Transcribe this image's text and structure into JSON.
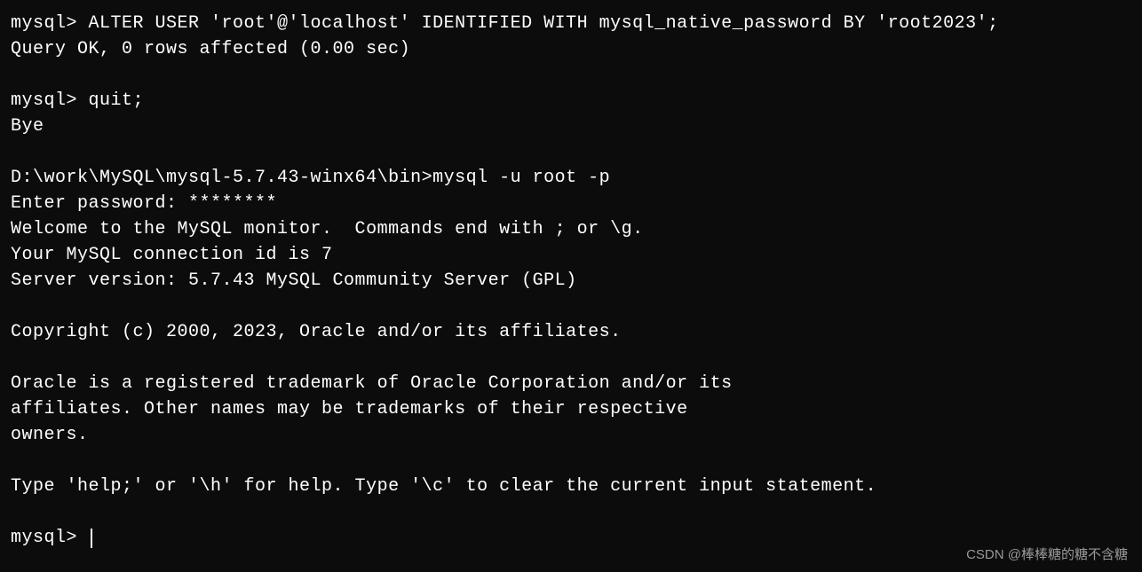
{
  "terminal": {
    "lines": [
      {
        "type": "prompt-cmd",
        "prompt": "mysql>",
        "command": " ALTER USER 'root'@'localhost' IDENTIFIED WITH mysql_native_password BY 'root2023';"
      },
      {
        "type": "output",
        "text": "Query OK, 0 rows affected (0.00 sec)"
      },
      {
        "type": "blank",
        "text": ""
      },
      {
        "type": "prompt-cmd",
        "prompt": "mysql>",
        "command": " quit;"
      },
      {
        "type": "output",
        "text": "Bye"
      },
      {
        "type": "blank",
        "text": ""
      },
      {
        "type": "shell-cmd",
        "prompt": "D:\\work\\MySQL\\mysql-5.7.43-winx64\\bin>",
        "command": "mysql -u root -p"
      },
      {
        "type": "output",
        "text": "Enter password: ********"
      },
      {
        "type": "output",
        "text": "Welcome to the MySQL monitor.  Commands end with ; or \\g."
      },
      {
        "type": "output",
        "text": "Your MySQL connection id is 7"
      },
      {
        "type": "output",
        "text": "Server version: 5.7.43 MySQL Community Server (GPL)"
      },
      {
        "type": "blank",
        "text": ""
      },
      {
        "type": "output",
        "text": "Copyright (c) 2000, 2023, Oracle and/or its affiliates."
      },
      {
        "type": "blank",
        "text": ""
      },
      {
        "type": "output",
        "text": "Oracle is a registered trademark of Oracle Corporation and/or its"
      },
      {
        "type": "output",
        "text": "affiliates. Other names may be trademarks of their respective"
      },
      {
        "type": "output",
        "text": "owners."
      },
      {
        "type": "blank",
        "text": ""
      },
      {
        "type": "output",
        "text": "Type 'help;' or '\\h' for help. Type '\\c' to clear the current input statement."
      },
      {
        "type": "blank",
        "text": ""
      },
      {
        "type": "prompt-active",
        "prompt": "mysql>",
        "command": " "
      }
    ]
  },
  "watermark": "CSDN @棒棒糖的糖不含糖"
}
